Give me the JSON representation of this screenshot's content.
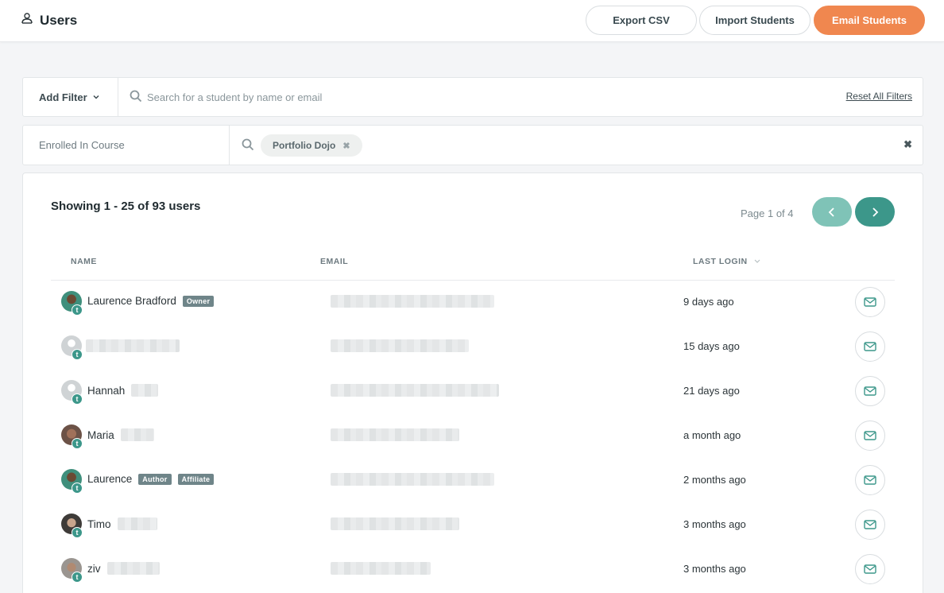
{
  "header": {
    "title": "Users",
    "buttons": {
      "export": "Export CSV",
      "import": "Import Students",
      "email": "Email Students"
    }
  },
  "filters": {
    "add_filter": "Add Filter",
    "search_placeholder": "Search for a student by name or email",
    "reset": "Reset All Filters",
    "course_label": "Enrolled In Course",
    "chip": "Portfolio Dojo",
    "chip_remove": "✖",
    "clear": "✖"
  },
  "table": {
    "showing": "Showing 1 - 25 of 93 users",
    "page_info": "Page 1 of 4",
    "columns": {
      "name": "NAME",
      "email": "EMAIL",
      "last_login": "LAST LOGIN"
    },
    "rows": [
      {
        "name": "Laurence Bradford",
        "badges": [
          "Owner"
        ],
        "last_login": "9 days ago",
        "avatar": "photo-green"
      },
      {
        "name": "",
        "badges": [],
        "last_login": "15 days ago",
        "avatar": "default"
      },
      {
        "name": "Hannah",
        "badges": [],
        "last_login": "21 days ago",
        "avatar": "default"
      },
      {
        "name": "Maria",
        "badges": [],
        "last_login": "a month ago",
        "avatar": "photo-brown"
      },
      {
        "name": "Laurence",
        "badges": [
          "Author",
          "Affiliate"
        ],
        "last_login": "2 months ago",
        "avatar": "photo-green"
      },
      {
        "name": "Timo",
        "badges": [],
        "last_login": "3 months ago",
        "avatar": "photo-dark"
      },
      {
        "name": "ziv",
        "badges": [],
        "last_login": "3 months ago",
        "avatar": "photo-gray"
      }
    ]
  },
  "badge_initial": "t",
  "colors": {
    "primary": "#f0874f",
    "teal": "#3c978a",
    "teal_light": "#7fc3b7"
  }
}
